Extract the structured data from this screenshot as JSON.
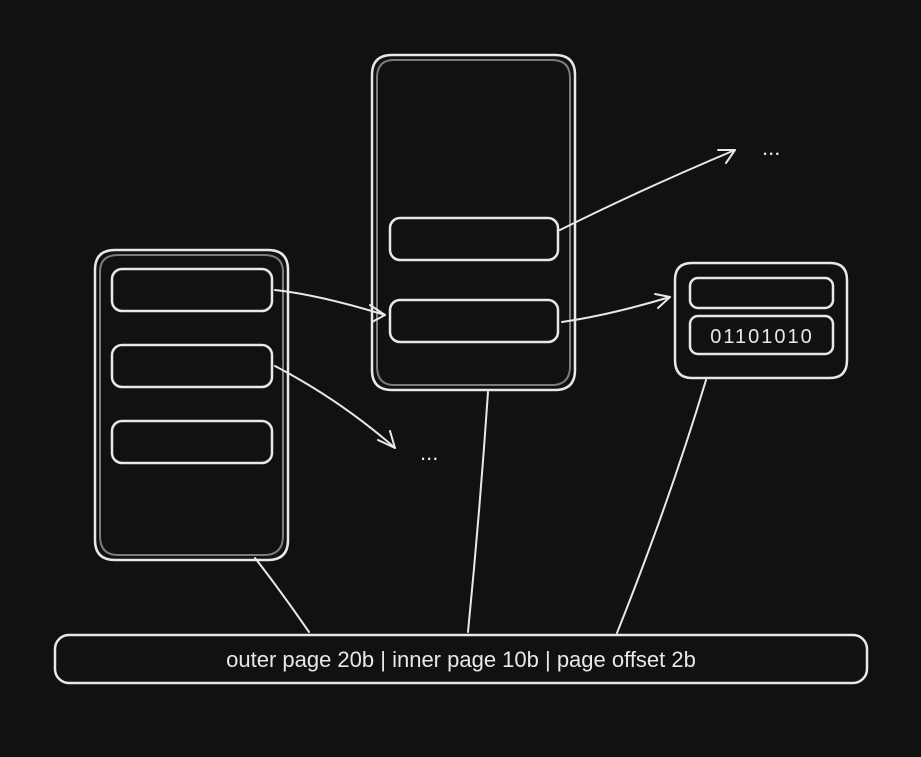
{
  "diagram": {
    "ellipsis_top": "...",
    "ellipsis_mid": "...",
    "binary_value": "01101010",
    "address_bar": "outer page 20b | inner page 10b | page offset 2b"
  }
}
